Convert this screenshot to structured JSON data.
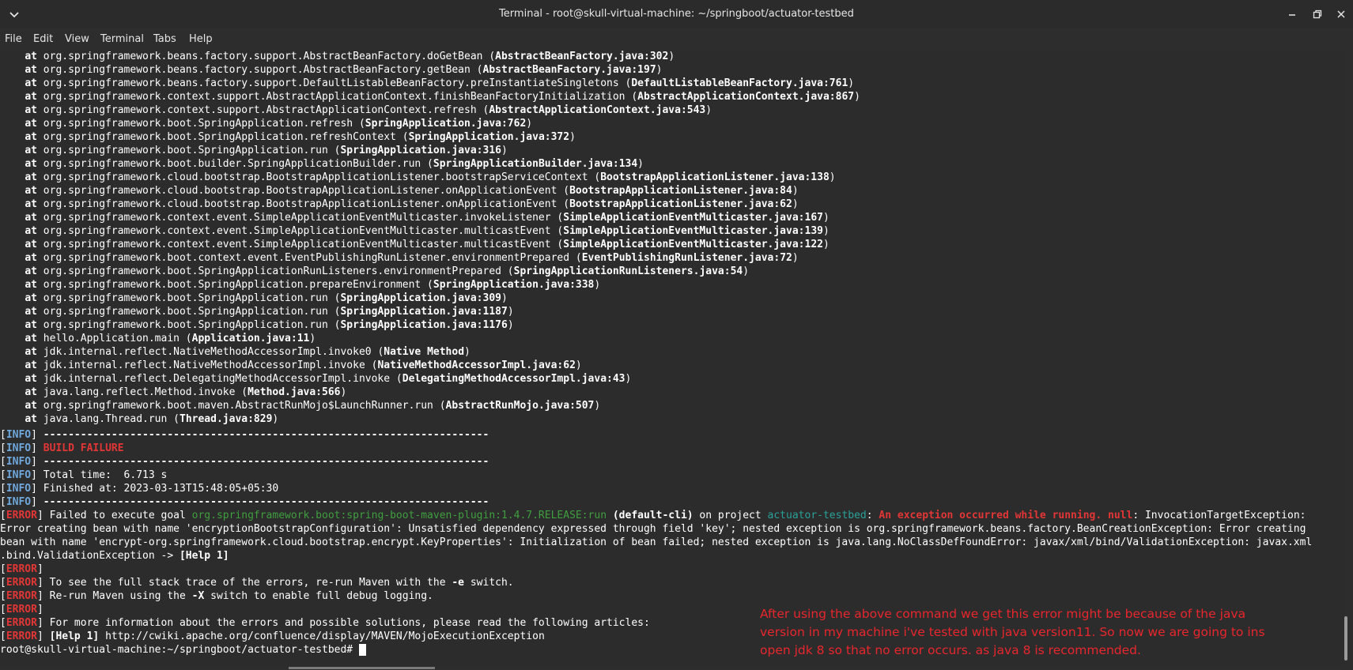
{
  "window": {
    "title": "Terminal - root@skull-virtual-machine: ~/springboot/actuator-testbed"
  },
  "menu": [
    "File",
    "Edit",
    "View",
    "Terminal",
    "Tabs",
    "Help"
  ],
  "stack": [
    {
      "m": "org.springframework.beans.factory.support.AbstractBeanFactory.doGetBean",
      "f": "AbstractBeanFactory.java:302"
    },
    {
      "m": "org.springframework.beans.factory.support.AbstractBeanFactory.getBean",
      "f": "AbstractBeanFactory.java:197"
    },
    {
      "m": "org.springframework.beans.factory.support.DefaultListableBeanFactory.preInstantiateSingletons",
      "f": "DefaultListableBeanFactory.java:761"
    },
    {
      "m": "org.springframework.context.support.AbstractApplicationContext.finishBeanFactoryInitialization",
      "f": "AbstractApplicationContext.java:867"
    },
    {
      "m": "org.springframework.context.support.AbstractApplicationContext.refresh",
      "f": "AbstractApplicationContext.java:543"
    },
    {
      "m": "org.springframework.boot.SpringApplication.refresh",
      "f": "SpringApplication.java:762"
    },
    {
      "m": "org.springframework.boot.SpringApplication.refreshContext",
      "f": "SpringApplication.java:372"
    },
    {
      "m": "org.springframework.boot.SpringApplication.run",
      "f": "SpringApplication.java:316"
    },
    {
      "m": "org.springframework.boot.builder.SpringApplicationBuilder.run",
      "f": "SpringApplicationBuilder.java:134"
    },
    {
      "m": "org.springframework.cloud.bootstrap.BootstrapApplicationListener.bootstrapServiceContext",
      "f": "BootstrapApplicationListener.java:138"
    },
    {
      "m": "org.springframework.cloud.bootstrap.BootstrapApplicationListener.onApplicationEvent",
      "f": "BootstrapApplicationListener.java:84"
    },
    {
      "m": "org.springframework.cloud.bootstrap.BootstrapApplicationListener.onApplicationEvent",
      "f": "BootstrapApplicationListener.java:62"
    },
    {
      "m": "org.springframework.context.event.SimpleApplicationEventMulticaster.invokeListener",
      "f": "SimpleApplicationEventMulticaster.java:167"
    },
    {
      "m": "org.springframework.context.event.SimpleApplicationEventMulticaster.multicastEvent",
      "f": "SimpleApplicationEventMulticaster.java:139"
    },
    {
      "m": "org.springframework.context.event.SimpleApplicationEventMulticaster.multicastEvent",
      "f": "SimpleApplicationEventMulticaster.java:122"
    },
    {
      "m": "org.springframework.boot.context.event.EventPublishingRunListener.environmentPrepared",
      "f": "EventPublishingRunListener.java:72"
    },
    {
      "m": "org.springframework.boot.SpringApplicationRunListeners.environmentPrepared",
      "f": "SpringApplicationRunListeners.java:54"
    },
    {
      "m": "org.springframework.boot.SpringApplication.prepareEnvironment",
      "f": "SpringApplication.java:338"
    },
    {
      "m": "org.springframework.boot.SpringApplication.run",
      "f": "SpringApplication.java:309"
    },
    {
      "m": "org.springframework.boot.SpringApplication.run",
      "f": "SpringApplication.java:1187"
    },
    {
      "m": "org.springframework.boot.SpringApplication.run",
      "f": "SpringApplication.java:1176"
    },
    {
      "m": "hello.Application.main",
      "f": "Application.java:11"
    },
    {
      "m": "jdk.internal.reflect.NativeMethodAccessorImpl.invoke0",
      "f": "Native Method"
    },
    {
      "m": "jdk.internal.reflect.NativeMethodAccessorImpl.invoke",
      "f": "NativeMethodAccessorImpl.java:62"
    },
    {
      "m": "jdk.internal.reflect.DelegatingMethodAccessorImpl.invoke",
      "f": "DelegatingMethodAccessorImpl.java:43"
    },
    {
      "m": "java.lang.reflect.Method.invoke",
      "f": "Method.java:566"
    },
    {
      "m": "org.springframework.boot.maven.AbstractRunMojo$LaunchRunner.run",
      "f": "AbstractRunMojo.java:507"
    },
    {
      "m": "java.lang.Thread.run",
      "f": "Thread.java:829"
    }
  ],
  "at_word": "at",
  "info_tag": "INFO",
  "error_tag": "ERROR",
  "dashes": "------------------------------------------------------------------------",
  "build_failure": "BUILD FAILURE",
  "total_time": "Total time:  6.713 s",
  "finished_at": "Finished at: 2023-03-13T15:48:05+05:30",
  "error_main": {
    "prefix": "Failed to execute goal ",
    "plugin": "org.springframework.boot:spring-boot-maven-plugin:1.4.7.RELEASE:run",
    "cli": "(default-cli)",
    "on_project": " on project ",
    "project": "actuator-testbed",
    "colon": ": ",
    "exception": "An exception occurred while running. null",
    "rest1": ": InvocationTargetException:",
    "line2": "Error creating bean with name 'encryptionBootstrapConfiguration': Unsatisfied dependency expressed through field 'key'; nested exception is org.springframework.beans.factory.BeanCreationException: Error creating",
    "line3": "bean with name 'encrypt-org.springframework.cloud.bootstrap.encrypt.KeyProperties': Initialization of bean failed; nested exception is java.lang.NoClassDefFoundError: javax/xml/bind/ValidationException: javax.xml",
    "line4": ".bind.ValidationException -> ",
    "help1": "[Help 1]"
  },
  "error_lines": {
    "stack_trace_a": "To see the full stack trace of the errors, re-run Maven with the ",
    "stack_trace_flag": "-e",
    "stack_trace_b": " switch.",
    "debug_a": "Re-run Maven using the ",
    "debug_flag": "-X",
    "debug_b": " switch to enable full debug logging.",
    "more_info": "For more information about the errors and possible solutions, please read the following articles:",
    "help_label": "[Help 1]",
    "help_url": " http://cwiki.apache.org/confluence/display/MAVEN/MojoExecutionException"
  },
  "prompt": "root@skull-virtual-machine:~/springboot/actuator-testbed# ",
  "annotation": [
    "After using the above command we get this error might be because of the java",
    "version in my machine i've tested with java version11. So now we are going to ins",
    "open jdk 8 so that no error occurs. as java 8 is recommended."
  ]
}
